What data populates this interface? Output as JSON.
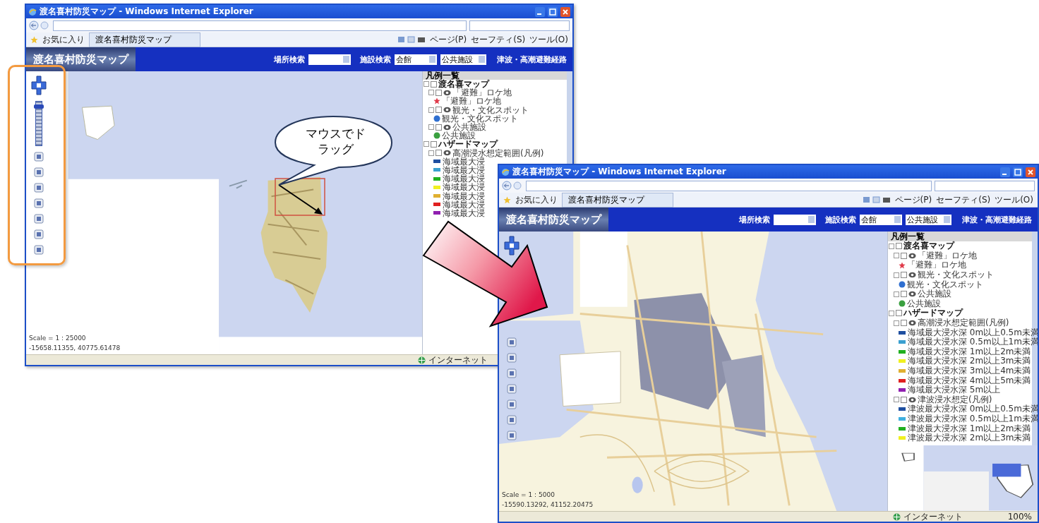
{
  "callout": {
    "text": "マウスでドラッグ"
  },
  "windows": [
    {
      "title": "渡名喜村防災マップ - Windows Internet Explorer",
      "favorites": "お気に入り",
      "tab": "渡名喜村防災マップ",
      "commands": [
        "ページ(P)",
        "セーフティ(S)",
        "ツール(O)"
      ],
      "app_title": "渡名喜村防災マップ",
      "filters": [
        {
          "label": "場所検索"
        },
        {
          "label": "施設検索",
          "value": "会館"
        },
        {
          "value": "公共施設"
        }
      ],
      "link": "津波・高潮避難経路",
      "zoom": {
        "level": 0.92
      },
      "legend": {
        "title": "凡例一覧",
        "items": [
          {
            "kind": "group",
            "label": "渡名喜マップ",
            "checked": false,
            "children": [
              {
                "kind": "layer",
                "label": "「避難」ロケ地",
                "checked": false,
                "children": [
                  {
                    "kind": "star",
                    "label": "「避難」ロケ地",
                    "color": "#e03a4a"
                  }
                ]
              },
              {
                "kind": "layer",
                "label": "観光・文化スポット",
                "checked": false,
                "children": [
                  {
                    "kind": "dot",
                    "label": "観光・文化スポット",
                    "color": "#2f6fd0"
                  }
                ]
              },
              {
                "kind": "layer",
                "label": "公共施設",
                "checked": false,
                "children": [
                  {
                    "kind": "dot",
                    "label": "公共施設",
                    "color": "#3aa040"
                  }
                ]
              }
            ]
          },
          {
            "kind": "group",
            "label": "ハザードマップ",
            "checked": false,
            "children": [
              {
                "kind": "layer",
                "label": "高潮浸水想定範囲(凡例)",
                "checked": false,
                "children": [
                  {
                    "kind": "swatch",
                    "label": "海域最大浸",
                    "color": "#1f4fa0"
                  },
                  {
                    "kind": "swatch",
                    "label": "海域最大浸",
                    "color": "#3aa0d0"
                  },
                  {
                    "kind": "swatch",
                    "label": "海域最大浸",
                    "color": "#20b020"
                  },
                  {
                    "kind": "swatch",
                    "label": "海域最大浸",
                    "color": "#f0f020"
                  },
                  {
                    "kind": "swatch",
                    "label": "海域最大浸",
                    "color": "#e0b030"
                  },
                  {
                    "kind": "swatch",
                    "label": "海域最大浸",
                    "color": "#e02020"
                  },
                  {
                    "kind": "swatch",
                    "label": "海域最大浸",
                    "color": "#9020b0"
                  }
                ]
              }
            ]
          }
        ]
      },
      "scale": "Scale = 1 : 25000",
      "coords": "-15658.11355, 40775.61478",
      "status": "インターネット"
    },
    {
      "title": "渡名喜村防災マップ - Windows Internet Explorer",
      "favorites": "お気に入り",
      "tab": "渡名喜村防災マップ",
      "commands": [
        "ページ(P)",
        "セーフティ(S)",
        "ツール(O)"
      ],
      "app_title": "渡名喜村防災マップ",
      "filters": [
        {
          "label": "場所検索"
        },
        {
          "label": "施設検索",
          "value": "会館"
        },
        {
          "value": "公共施設"
        }
      ],
      "link": "津波・高潮避難経路",
      "legend": {
        "title": "凡例一覧",
        "items": [
          {
            "kind": "group",
            "label": "渡名喜マップ",
            "checked": false,
            "children": [
              {
                "kind": "layer",
                "label": "「避難」ロケ地",
                "checked": false,
                "children": [
                  {
                    "kind": "star",
                    "label": "「避難」ロケ地",
                    "color": "#e03a4a"
                  }
                ]
              },
              {
                "kind": "layer",
                "label": "観光・文化スポット",
                "checked": false,
                "children": [
                  {
                    "kind": "dot",
                    "label": "観光・文化スポット",
                    "color": "#2f6fd0"
                  }
                ]
              },
              {
                "kind": "layer",
                "label": "公共施設",
                "checked": false,
                "children": [
                  {
                    "kind": "dot",
                    "label": "公共施設",
                    "color": "#3aa040"
                  }
                ]
              }
            ]
          },
          {
            "kind": "group",
            "label": "ハザードマップ",
            "checked": false,
            "children": [
              {
                "kind": "layer",
                "label": "高潮浸水想定範囲(凡例)",
                "checked": false,
                "children": [
                  {
                    "kind": "swatch",
                    "label": "海域最大浸水深 0m以上0.5m未満",
                    "color": "#1f4fa0"
                  },
                  {
                    "kind": "swatch",
                    "label": "海域最大浸水深 0.5m以上1m未満",
                    "color": "#3aa0d0"
                  },
                  {
                    "kind": "swatch",
                    "label": "海域最大浸水深 1m以上2m未満",
                    "color": "#20b020"
                  },
                  {
                    "kind": "swatch",
                    "label": "海域最大浸水深 2m以上3m未満",
                    "color": "#f0f020"
                  },
                  {
                    "kind": "swatch",
                    "label": "海域最大浸水深 3m以上4m未満",
                    "color": "#e0b030"
                  },
                  {
                    "kind": "swatch",
                    "label": "海域最大浸水深 4m以上5m未満",
                    "color": "#e02020"
                  },
                  {
                    "kind": "swatch",
                    "label": "海域最大浸水深 5m以上",
                    "color": "#9020b0"
                  }
                ]
              },
              {
                "kind": "layer",
                "label": "津波浸水想定(凡例)",
                "checked": false,
                "children": [
                  {
                    "kind": "swatch",
                    "label": "津波最大浸水深 0m以上0.5m未満",
                    "color": "#1f4fa0"
                  },
                  {
                    "kind": "swatch",
                    "label": "津波最大浸水深 0.5m以上1m未満",
                    "color": "#40b0e0"
                  },
                  {
                    "kind": "swatch",
                    "label": "津波最大浸水深 1m以上2m未満",
                    "color": "#20b020"
                  },
                  {
                    "kind": "swatch",
                    "label": "津波最大浸水深 2m以上3m未満",
                    "color": "#f0f020"
                  }
                ]
              }
            ]
          }
        ]
      },
      "minimap": true,
      "scale": "Scale = 1 : 5000",
      "coords": "-15590.13292, 41152.20475",
      "status": "インターネット",
      "zoom_text": "100%"
    }
  ]
}
